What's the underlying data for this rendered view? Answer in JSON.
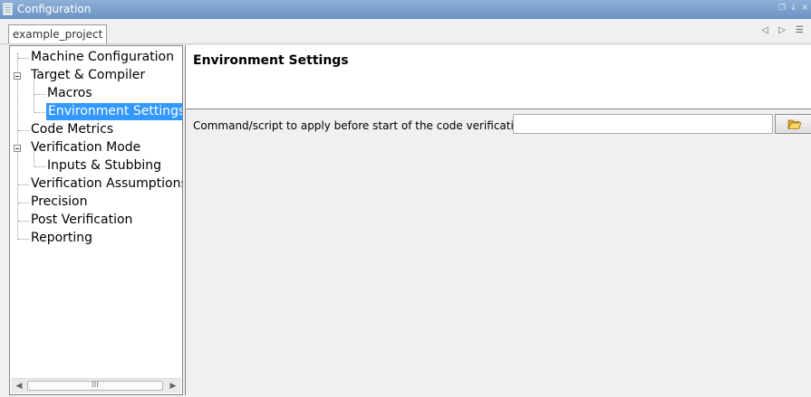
{
  "window": {
    "title": "Configuration",
    "controls_glyphs": "❐ ↓ ✕"
  },
  "tabs": [
    {
      "label": "example_project",
      "active": true
    }
  ],
  "tab_nav": {
    "glyphs": "◁ ▷ ☰"
  },
  "tree": {
    "items": [
      {
        "label": "Machine Configuration",
        "level": 0
      },
      {
        "label": "Target & Compiler",
        "level": 0,
        "expanded": true
      },
      {
        "label": "Macros",
        "level": 1
      },
      {
        "label": "Environment Settings",
        "level": 1,
        "selected": true
      },
      {
        "label": "Code Metrics",
        "level": 0
      },
      {
        "label": "Verification Mode",
        "level": 0,
        "expanded": true
      },
      {
        "label": "Inputs & Stubbing",
        "level": 1
      },
      {
        "label": "Verification Assumptions",
        "level": 0
      },
      {
        "label": "Precision",
        "level": 0
      },
      {
        "label": "Post Verification",
        "level": 0
      },
      {
        "label": "Reporting",
        "level": 0
      }
    ],
    "scrollbar": {
      "thumb_grip": "III",
      "left_arrow": "◀",
      "right_arrow": "▶"
    }
  },
  "main": {
    "title": "Environment Settings",
    "field_label": "Command/script to apply before start of the code verification",
    "field_value": "",
    "browse_icon": "folder-open-icon"
  },
  "colors": {
    "titlebar": "#7aa0cf",
    "selection": "#3399ff",
    "folder": "#f5c542"
  }
}
